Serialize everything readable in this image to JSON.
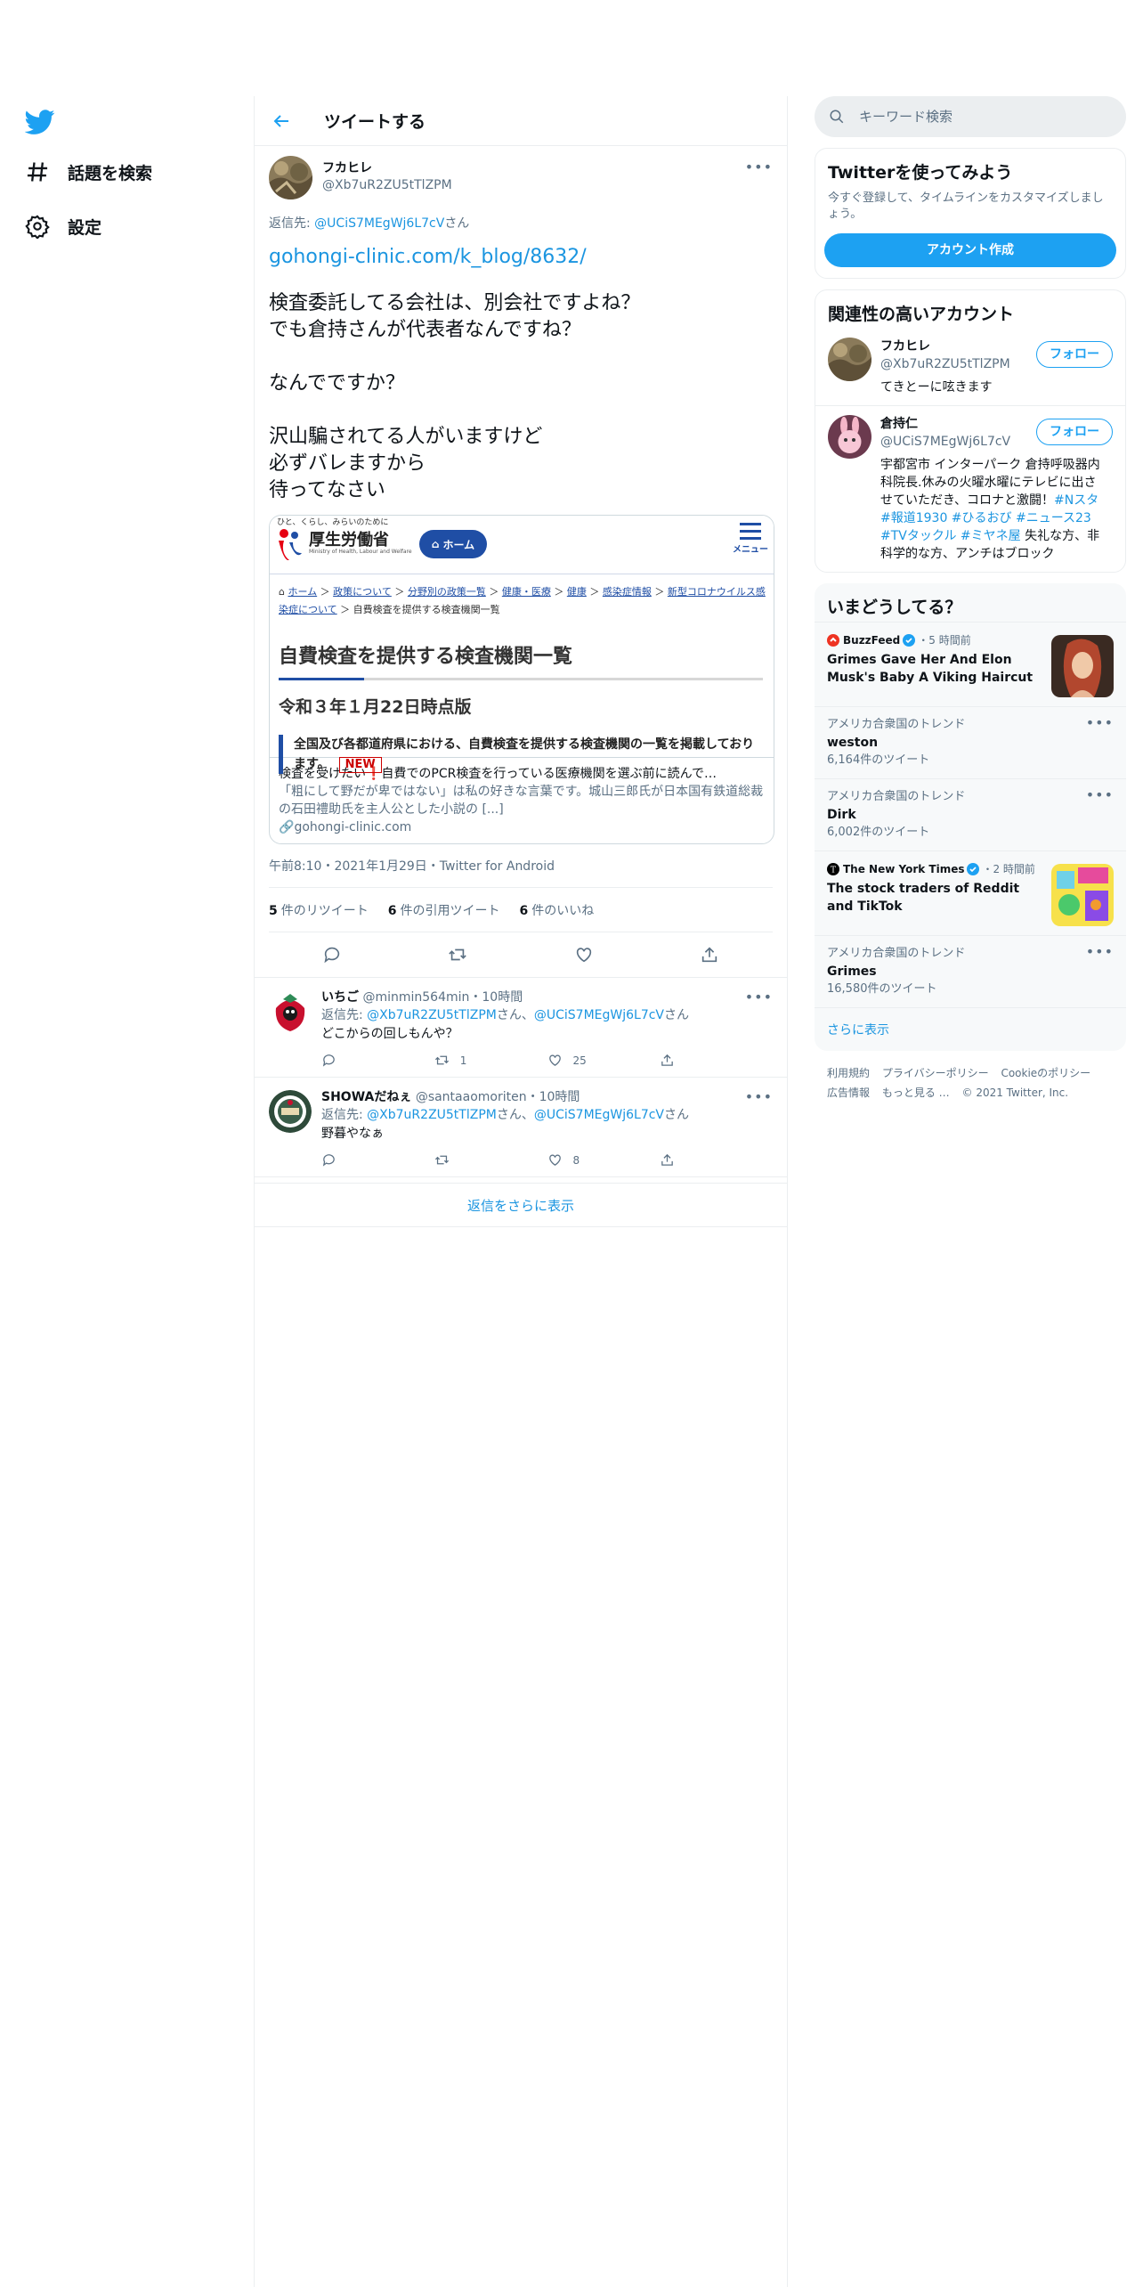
{
  "nav": {
    "explore": "話題を検索",
    "settings": "設定"
  },
  "header": {
    "title": "ツイートする"
  },
  "tweet": {
    "name": "フカヒレ",
    "handle": "@Xb7uR2ZU5tTlZPM",
    "reply_prefix": "返信先: ",
    "reply_handle": "@UCiS7MEgWj6L7cV",
    "reply_suffix": "さん",
    "link": "gohongi-clinic.com/k_blog/8632/",
    "text": "検査委託してる会社は、別会社ですよね？\nでも倉持さんが代表者なんですね？\n\nなんでですか？\n\n沢山騙されてる人がいますけど\n必ずバレますから\n待ってなさい",
    "card": {
      "image": {
        "tagline": "ひと、くらし、みらいのために",
        "logo_name": "厚生労働省",
        "logo_sub": "Ministry of Health, Labour and Welfare",
        "home": "ホーム",
        "menu": "メニュー",
        "crumbs": [
          "ホーム",
          "政策について",
          "分野別の政策一覧",
          "健康・医療",
          "健康",
          "感染症情報",
          "新型コロナウイルス感染症について"
        ],
        "crumb_current": "自費検査を提供する検査機関一覧",
        "h1": "自費検査を提供する検査機関一覧",
        "h2": "令和３年１月22日時点版",
        "notice": "全国及び各都道府県における、自費検査を提供する検査機関の一覧を掲載しております。",
        "new": "NEW"
      },
      "title": "検査を受けたい❗自費でのPCR検査を行っている医療機関を選ぶ前に読んで…",
      "description": "「粗にして野だが卑ではない」は私の好きな言葉です。城山三郎氏が日本国有鉄道総裁の石田禮助氏を主人公とした小説の [...]",
      "domain": "gohongi-clinic.com"
    },
    "meta": "午前8:10・2021年1月29日・Twitter for Android",
    "stats": [
      {
        "count": "5",
        "label": "件のリツイート"
      },
      {
        "count": "6",
        "label": "件の引用ツイート"
      },
      {
        "count": "6",
        "label": "件のいいね"
      }
    ]
  },
  "replies": [
    {
      "name": "いちご",
      "handle": "@minmin564min",
      "time": "・10時間",
      "reply_prefix": "返信先: ",
      "reply_handles": [
        "@Xb7uR2ZU5tTlZPM",
        "@UCiS7MEgWj6L7cV"
      ],
      "san": "さん、",
      "san2": "さん",
      "text": "どこからの回しもんや？",
      "retweets": "1",
      "likes": "25"
    },
    {
      "name": "SHOWAだねぇ",
      "handle": "@santaaomoriten",
      "time": "・10時間",
      "reply_prefix": "返信先: ",
      "reply_handles": [
        "@Xb7uR2ZU5tTlZPM",
        "@UCiS7MEgWj6L7cV"
      ],
      "san": "さん、",
      "san2": "さん",
      "text": "野暮やなぁ",
      "retweets": "",
      "likes": "8"
    }
  ],
  "show_more_replies": "返信をさらに表示",
  "right": {
    "search_placeholder": "キーワード検索",
    "promo": {
      "title": "Twitterを使ってみよう",
      "text": "今すぐ登録して、タイムラインをカスタマイズしましょう。",
      "button": "アカウント作成"
    },
    "related": {
      "title": "関連性の高いアカウント",
      "follow": "フォロー",
      "accounts": [
        {
          "name": "フカヒレ",
          "handle": "@Xb7uR2ZU5tTlZPM",
          "bio": "てきとーに呟きます"
        },
        {
          "name": "倉持仁",
          "handle": "@UCiS7MEgWj6L7cV",
          "bio": "宇都宮市 インターパーク 倉持呼吸器内科院長.休みの火曜水曜にテレビに出させていただき、コロナと激闘！",
          "tags": "#Nスタ #報道1930 #ひるおび #ニュース23 #TVタックル #ミヤネ屋",
          "bio_tail": " 失礼な方、非科学的な方、アンチはブロック"
        }
      ]
    },
    "trends": {
      "title": "いまどうしてる？",
      "news1": {
        "source": "BuzzFeed",
        "time": "・5 時間前",
        "headline": "Grimes Gave Her And Elon Musk's Baby A Viking Haircut"
      },
      "trend1": {
        "context": "アメリカ合衆国のトレンド",
        "name": "weston",
        "count": "6,164件のツイート"
      },
      "trend2": {
        "context": "アメリカ合衆国のトレンド",
        "name": "Dirk",
        "count": "6,002件のツイート"
      },
      "news2": {
        "source": "The New York Times",
        "time": "・2 時間前",
        "headline": "The stock traders of Reddit and TikTok"
      },
      "trend3": {
        "context": "アメリカ合衆国のトレンド",
        "name": "Grimes",
        "count": "16,580件のツイート"
      },
      "show_more": "さらに表示"
    },
    "footer": {
      "terms": "利用規約",
      "privacy": "プライバシーポリシー",
      "cookie": "Cookieのポリシー",
      "ads": "広告情報",
      "more": "もっと見る …",
      "copyright": "© 2021 Twitter, Inc."
    }
  },
  "colors": {
    "accent": "#1da1f2",
    "link": "#1b95e0",
    "muted": "#5b7083",
    "border": "#ebeef0"
  }
}
